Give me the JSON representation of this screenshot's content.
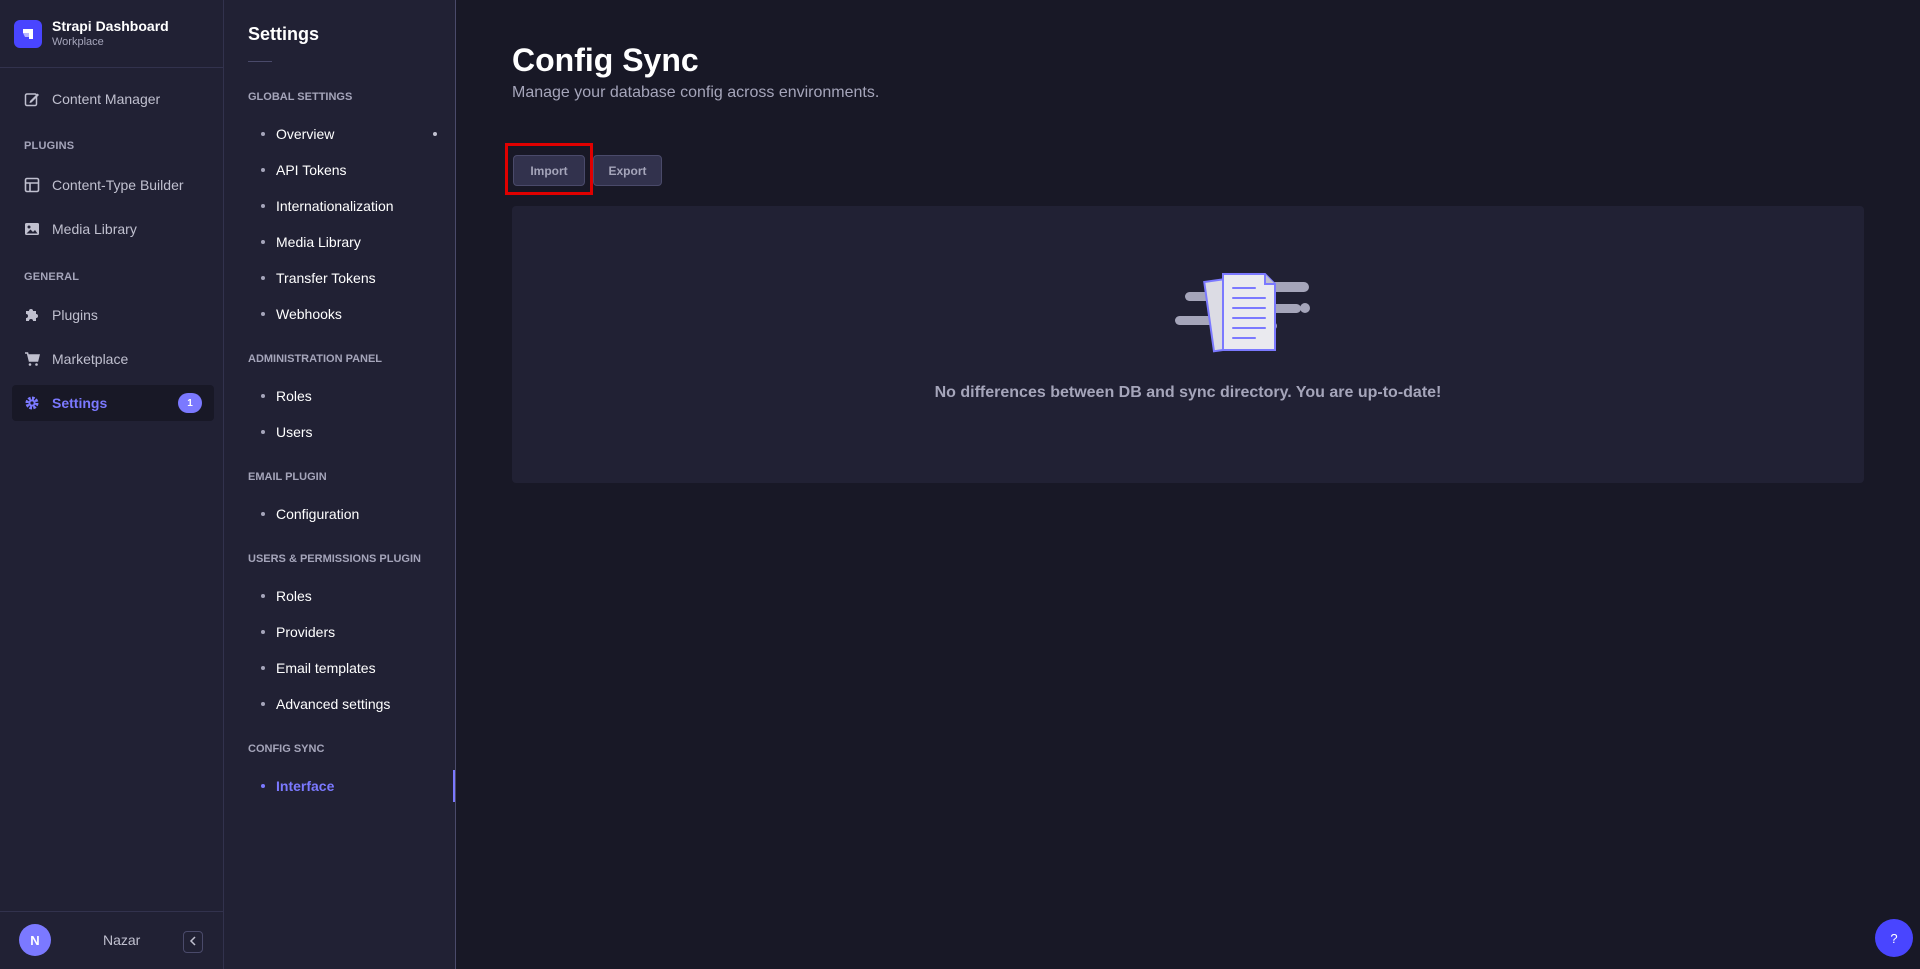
{
  "brand": {
    "title": "Strapi Dashboard",
    "subtitle": "Workplace"
  },
  "mainnav": {
    "content_manager": "Content Manager",
    "plugins_section": "PLUGINS",
    "content_type_builder": "Content-Type Builder",
    "media_library": "Media Library",
    "general_section": "GENERAL",
    "plugins": "Plugins",
    "marketplace": "Marketplace",
    "settings": "Settings",
    "settings_badge": "1",
    "user_initial": "N",
    "username": "Nazar"
  },
  "subnav": {
    "title": "Settings",
    "global_section": "GLOBAL SETTINGS",
    "global_items": [
      "Overview",
      "API Tokens",
      "Internationalization",
      "Media Library",
      "Transfer Tokens",
      "Webhooks"
    ],
    "admin_section": "ADMINISTRATION PANEL",
    "admin_items": [
      "Roles",
      "Users"
    ],
    "email_section": "EMAIL PLUGIN",
    "email_items": [
      "Configuration"
    ],
    "users_section": "USERS & PERMISSIONS PLUGIN",
    "users_items": [
      "Roles",
      "Providers",
      "Email templates",
      "Advanced settings"
    ],
    "config_section": "CONFIG SYNC",
    "config_items": [
      "Interface"
    ]
  },
  "main": {
    "title": "Config Sync",
    "subtitle": "Manage your database config across environments.",
    "import_label": "Import",
    "export_label": "Export",
    "empty_message": "No differences between DB and sync directory. You are up-to-date!"
  },
  "help": {
    "label": "?"
  },
  "colors": {
    "accent": "#7b79ff",
    "primary": "#4945ff",
    "background": "#181826",
    "panel": "#212134",
    "highlight": "#e00000"
  }
}
